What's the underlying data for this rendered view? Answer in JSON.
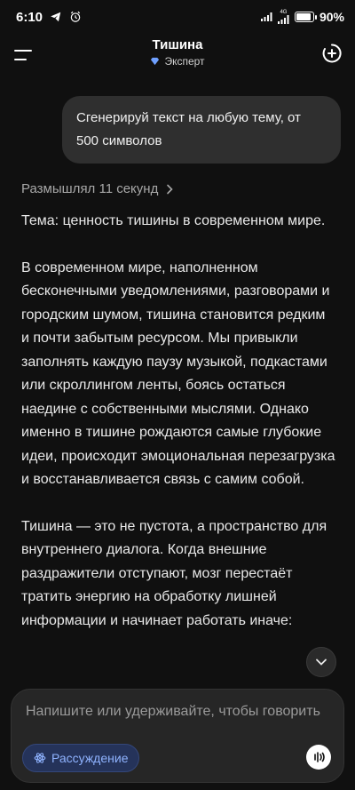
{
  "status_bar": {
    "time": "6:10",
    "battery": "90%",
    "network": "4G"
  },
  "header": {
    "title": "Тишина",
    "mode": "Эксперт"
  },
  "user_message": "Сгенерируй текст на любую тему, от 500 символов",
  "thinking": {
    "label": "Размышлял 11 секунд"
  },
  "answer": {
    "paragraphs": [
      "Тема: ценность тишины в современном мире.",
      "В современном мире, наполненном бесконечными уведомлениями, разговорами и городским шумом, тишина становится редким и почти забытым ресурсом. Мы привыкли заполнять каждую паузу музыкой, подкастами или скроллингом ленты, боясь остаться наедине с собственными мыслями. Однако именно в тишине рождаются самые глубокие идеи, происходит эмоциональная перезагрузка и восстанавливается связь с самим собой.",
      "Тишина — это не пустота, а пространство для внутреннего диалога. Когда внешние раздражители отступают, мозг перестаёт тратить энергию на обработку лишней информации и начинает работать иначе:"
    ]
  },
  "composer": {
    "placeholder": "Напишите или удерживайте, чтобы говорить",
    "reasoning_label": "Рассуждение"
  },
  "colors": {
    "background": "#101010",
    "bubble": "#2f2f2f",
    "accent": "#8fb3ff",
    "chip_bg": "#25335a"
  }
}
